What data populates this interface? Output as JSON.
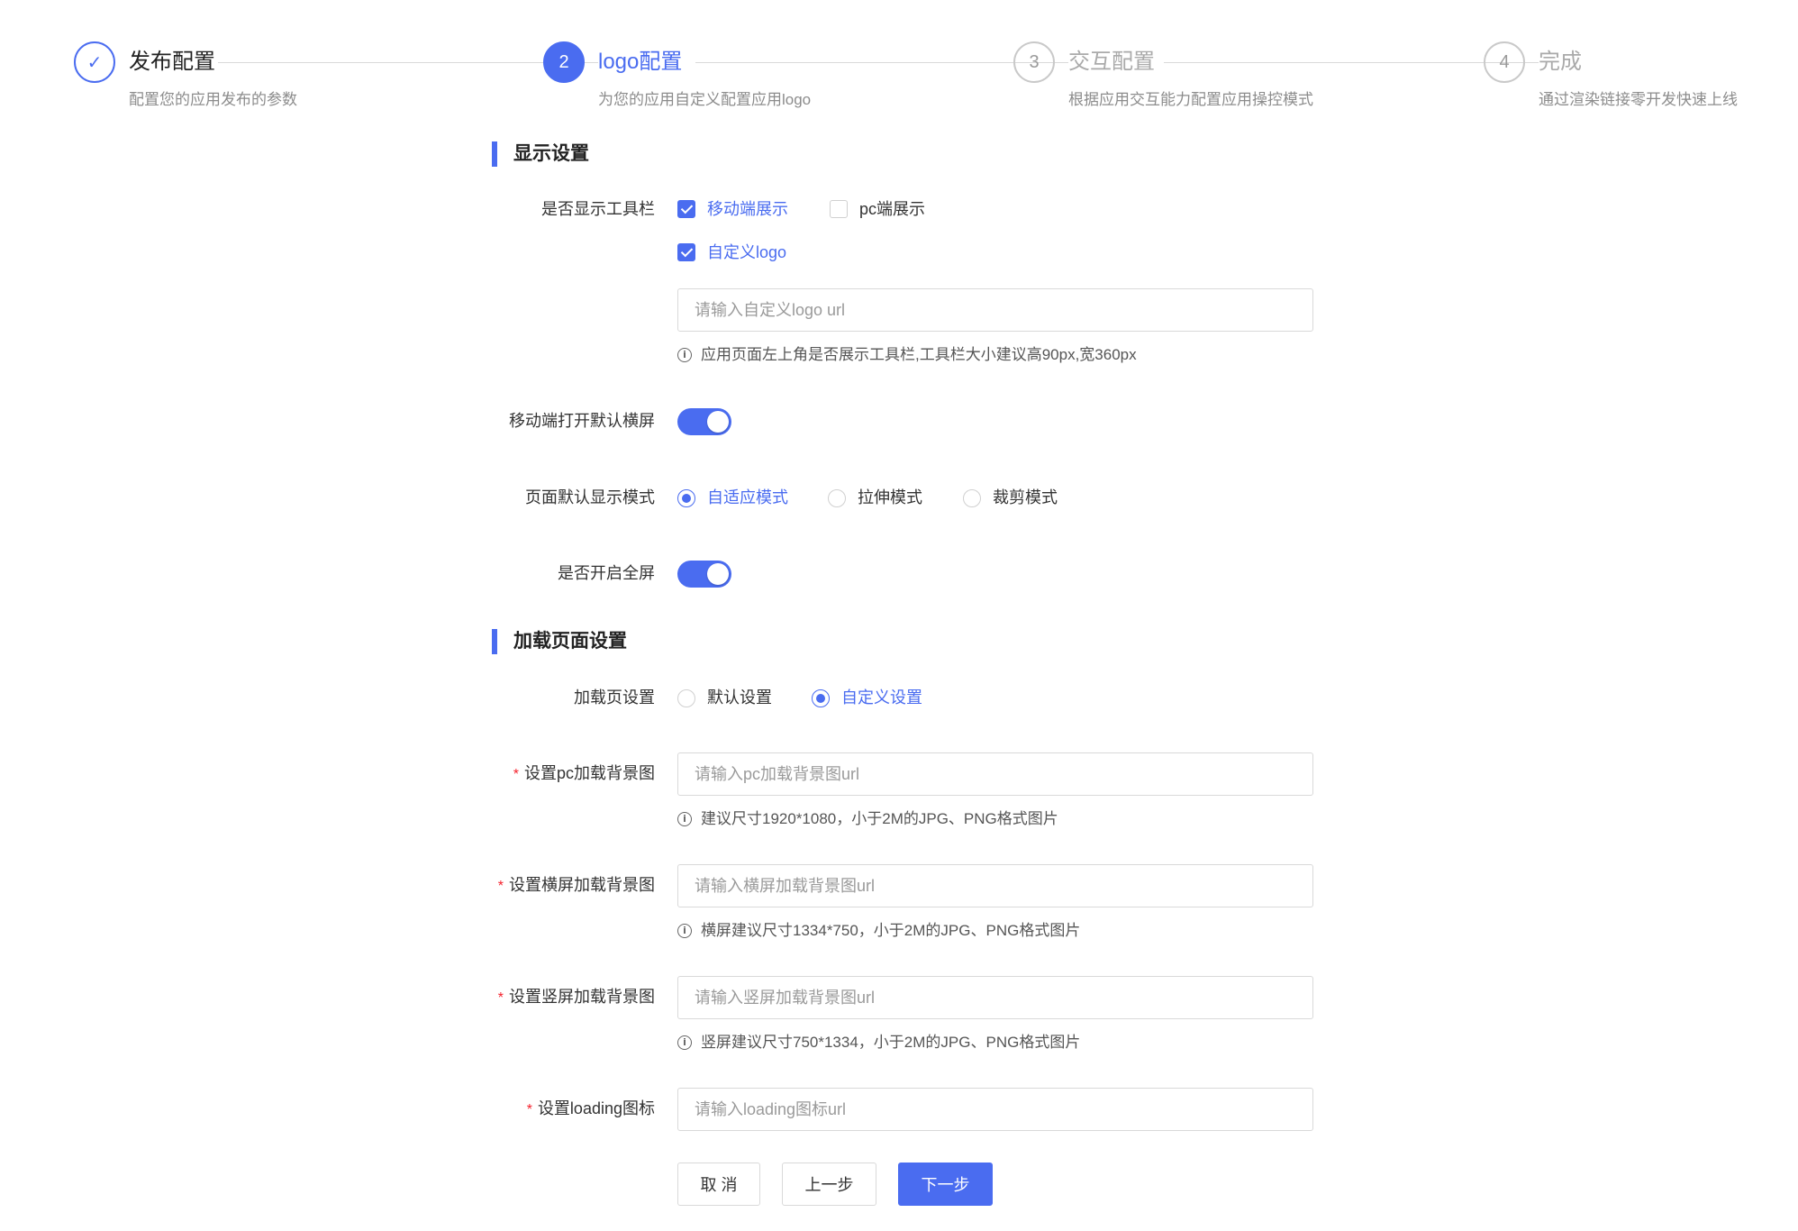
{
  "steps": [
    {
      "title": "发布配置",
      "desc": "配置您的应用发布的参数",
      "marker": "✓",
      "state": "done"
    },
    {
      "title": "logo配置",
      "desc": "为您的应用自定义配置应用logo",
      "marker": "2",
      "state": "active"
    },
    {
      "title": "交互配置",
      "desc": "根据应用交互能力配置应用操控模式",
      "marker": "3",
      "state": "pending"
    },
    {
      "title": "完成",
      "desc": "通过渲染链接零开发快速上线",
      "marker": "4",
      "state": "pending"
    }
  ],
  "display_section": {
    "title": "显示设置",
    "toolbar": {
      "label": "是否显示工具栏",
      "mobile": {
        "label": "移动端展示",
        "checked": true
      },
      "pc": {
        "label": "pc端展示",
        "checked": false
      },
      "custom_logo": {
        "label": "自定义logo",
        "checked": true
      },
      "logo_input": {
        "placeholder": "请输入自定义logo url",
        "value": ""
      },
      "hint": "应用页面左上角是否展示工具栏,工具栏大小建议高90px,宽360px"
    },
    "landscape": {
      "label": "移动端打开默认横屏",
      "on": true
    },
    "display_mode": {
      "label": "页面默认显示模式",
      "options": [
        {
          "label": "自适应模式",
          "checked": true
        },
        {
          "label": "拉伸模式",
          "checked": false
        },
        {
          "label": "裁剪模式",
          "checked": false
        }
      ]
    },
    "fullscreen": {
      "label": "是否开启全屏",
      "on": true
    }
  },
  "loading_section": {
    "title": "加载页面设置",
    "loading_page": {
      "label": "加载页设置",
      "options": [
        {
          "label": "默认设置",
          "checked": false
        },
        {
          "label": "自定义设置",
          "checked": true
        }
      ]
    },
    "pc_bg": {
      "required_mark": "*",
      "label": "设置pc加载背景图",
      "placeholder": "请输入pc加载背景图url",
      "hint": "建议尺寸1920*1080，小于2M的JPG、PNG格式图片"
    },
    "landscape_bg": {
      "required_mark": "*",
      "label": "设置横屏加载背景图",
      "placeholder": "请输入横屏加载背景图url",
      "hint": "横屏建议尺寸1334*750，小于2M的JPG、PNG格式图片"
    },
    "portrait_bg": {
      "required_mark": "*",
      "label": "设置竖屏加载背景图",
      "placeholder": "请输入竖屏加载背景图url",
      "hint": "竖屏建议尺寸750*1334，小于2M的JPG、PNG格式图片"
    },
    "loading_icon": {
      "required_mark": "*",
      "label": "设置loading图标",
      "placeholder": "请输入loading图标url"
    }
  },
  "buttons": {
    "cancel": "取 消",
    "prev": "上一步",
    "next": "下一步"
  },
  "info_icon_glyph": "i",
  "colors": {
    "accent": "#4a6cf0",
    "required": "#f5222d"
  }
}
